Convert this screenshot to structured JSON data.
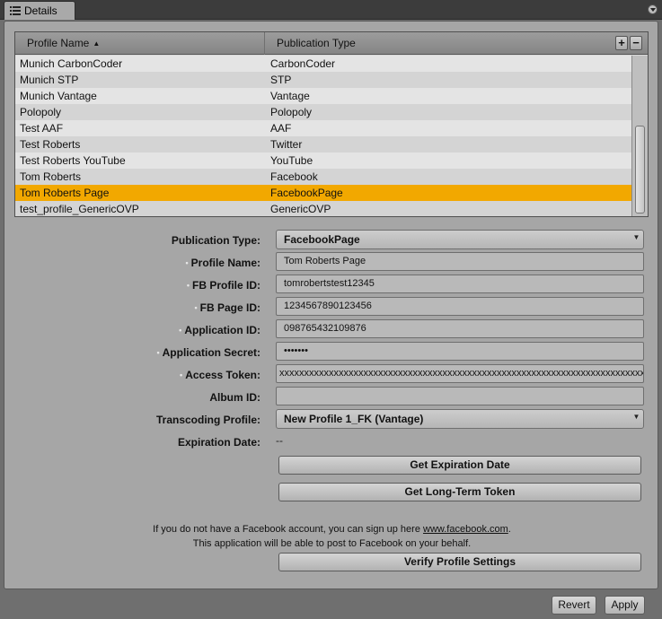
{
  "tab": {
    "title": "Details"
  },
  "table": {
    "columns": [
      "Profile Name",
      "Publication Type"
    ],
    "sort_indicator": "▲",
    "add_label": "+",
    "remove_label": "−",
    "rows": [
      {
        "name": "Munich CarbonCoder",
        "type": "CarbonCoder"
      },
      {
        "name": "Munich STP",
        "type": "STP"
      },
      {
        "name": "Munich Vantage",
        "type": "Vantage"
      },
      {
        "name": "Polopoly",
        "type": "Polopoly"
      },
      {
        "name": "Test AAF",
        "type": "AAF"
      },
      {
        "name": "Test Roberts",
        "type": "Twitter"
      },
      {
        "name": "Test Roberts YouTube",
        "type": "YouTube"
      },
      {
        "name": "Tom Roberts",
        "type": "Facebook"
      },
      {
        "name": "Tom Roberts Page",
        "type": "FacebookPage",
        "selected": true
      },
      {
        "name": "test_profile_GenericOVP",
        "type": "GenericOVP"
      }
    ]
  },
  "form": {
    "publication_type": {
      "label": "Publication Type:",
      "value": "FacebookPage"
    },
    "profile_name": {
      "label": "Profile Name:",
      "value": "Tom Roberts Page"
    },
    "fb_profile_id": {
      "label": "FB Profile ID:",
      "value": "tomrobertstest12345"
    },
    "fb_page_id": {
      "label": "FB Page ID:",
      "value": "1234567890123456"
    },
    "application_id": {
      "label": "Application ID:",
      "value": "098765432109876"
    },
    "application_secret": {
      "label": "Application Secret:",
      "value": "•••••••"
    },
    "access_token": {
      "label": "Access Token:",
      "value": "xxxxxxxxxxxxxxxxxxxxxxxxxxxxxxxxxxxxxxxxxxxxxxxxxxxxxxxxxxxxxxxxxxxxxxxxxxxxxx"
    },
    "album_id": {
      "label": "Album ID:",
      "value": ""
    },
    "transcoding_profile": {
      "label": "Transcoding Profile:",
      "value": "New Profile 1_FK (Vantage)"
    },
    "expiration_date": {
      "label": "Expiration Date:",
      "value": "--"
    }
  },
  "buttons": {
    "get_expiration": "Get Expiration Date",
    "get_long_term": "Get Long-Term Token",
    "verify": "Verify Profile Settings",
    "revert": "Revert",
    "apply": "Apply"
  },
  "notes": {
    "line1_prefix": "If you do not have a Facebook account, you can sign up here ",
    "line1_link": "www.facebook.com",
    "line1_suffix": ".",
    "line2": "This application will be able to post to Facebook on your behalf."
  },
  "bullet": "•",
  "colors": {
    "selected_row": "#f2a800",
    "panel": "#a6a6a6"
  }
}
